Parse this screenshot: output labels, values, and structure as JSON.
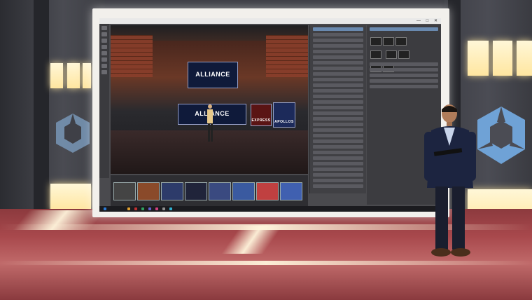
{
  "viewport": {
    "screens": [
      {
        "label": "ALLIANCE"
      },
      {
        "label": "ALLIANCE"
      },
      {
        "label": "EXPRESS"
      },
      {
        "label": "APOLLOS"
      }
    ]
  },
  "colors": {
    "floor": "#a8484c",
    "wall": "#3f4047",
    "light": "#ffe6a0",
    "cube_logo": "#6fa2d6",
    "app_bg": "#4a4a4e",
    "panel": "#404044"
  },
  "icons": {
    "left_cube": "cube-logo-icon",
    "right_cube": "cube-logo-icon"
  }
}
